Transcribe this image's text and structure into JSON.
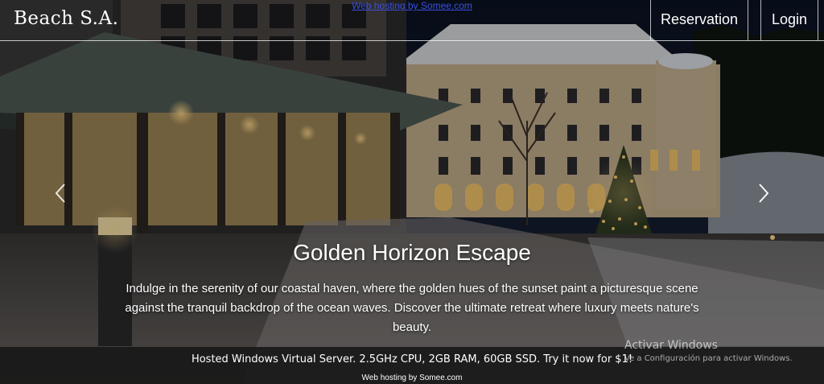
{
  "top_link": {
    "text": "Web hosting by Somee.com"
  },
  "header": {
    "brand": "Beach S.A.",
    "nav": {
      "reservation": "Reservation",
      "login": "Login"
    }
  },
  "carousel": {
    "prev_icon": "chevron-left-icon",
    "next_icon": "chevron-right-icon",
    "title": "Golden Horizon Escape",
    "description": "Indulge in the serenity of our coastal haven, where the golden hues of the sunset paint a picturesque scene against the tranquil backdrop of the ocean waves. Discover the ultimate retreat where luxury meets nature's beauty."
  },
  "ad_bar": {
    "text": "Hosted Windows Virtual Server. 2.5GHz CPU, 2GB RAM, 60GB SSD. Try it now for $1!",
    "host": "Web hosting by Somee.com"
  },
  "watermark": {
    "title": "Activar Windows",
    "subtitle": "Ve a Configuración para activar Windows."
  },
  "colors": {
    "text": "#ffffff",
    "link_blue": "#3a4fe0",
    "ad_bar": "#161616",
    "sky": "#0d1420"
  }
}
